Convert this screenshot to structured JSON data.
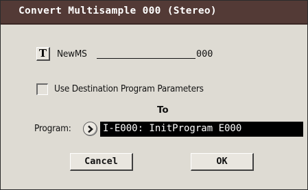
{
  "dialog": {
    "title": "Convert Multisample 000 (Stereo)"
  },
  "name_field": {
    "text_edit_label": "T",
    "name": "NewMS",
    "number": "000"
  },
  "options": {
    "use_destination_label": "Use Destination Program Parameters",
    "use_destination_checked": false
  },
  "destination": {
    "to_label": "To",
    "program_label": "Program:",
    "program_value": "I-E000: InitProgram E000"
  },
  "buttons": {
    "cancel_label": "Cancel",
    "ok_label": "OK"
  },
  "colors": {
    "title_bar": "#533a36",
    "dialog_bg": "#dedbd3",
    "program_field_bg": "#000000"
  },
  "icons": {
    "program_select": "chevron-right-icon"
  }
}
